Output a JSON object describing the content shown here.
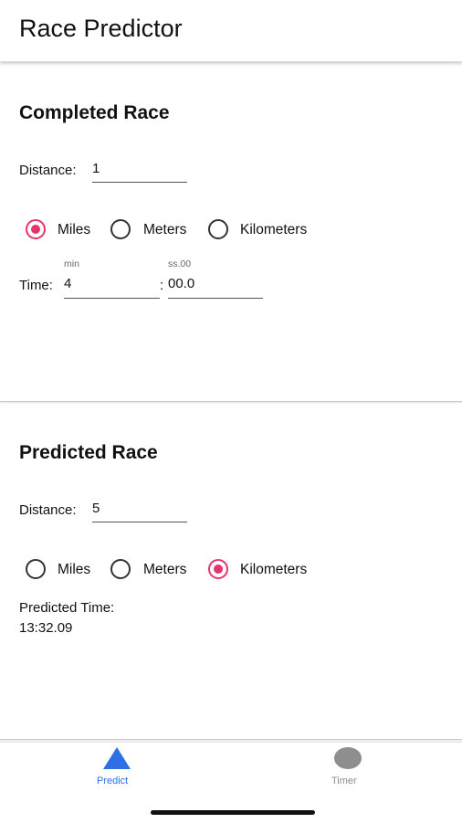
{
  "app": {
    "title": "Race Predictor"
  },
  "completed": {
    "title": "Completed Race",
    "distance_label": "Distance:",
    "distance_value": "1",
    "units": [
      {
        "label": "Miles",
        "selected": true
      },
      {
        "label": "Meters",
        "selected": false
      },
      {
        "label": "Kilometers",
        "selected": false
      }
    ],
    "time_label": "Time:",
    "min_hint": "min",
    "sec_hint": "ss.00",
    "min_value": "4",
    "separator": ":",
    "sec_value": "00.0"
  },
  "predicted": {
    "title": "Predicted Race",
    "distance_label": "Distance:",
    "distance_value": "5",
    "units": [
      {
        "label": "Miles",
        "selected": false
      },
      {
        "label": "Meters",
        "selected": false
      },
      {
        "label": "Kilometers",
        "selected": true
      }
    ],
    "result_label": "Predicted Time:",
    "result_value": "13:32.09"
  },
  "tabs": [
    {
      "label": "Predict",
      "icon": "triangle-icon",
      "active": true
    },
    {
      "label": "Timer",
      "icon": "circle-icon",
      "active": false
    }
  ],
  "colors": {
    "accent": "#e8336b",
    "active_tab": "#2f6fe4",
    "inactive_tab": "#8e8e8e"
  }
}
